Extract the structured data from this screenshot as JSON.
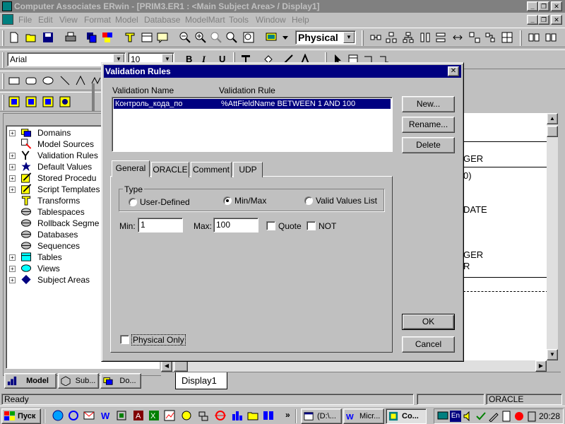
{
  "app": {
    "title": "Computer Associates ERwin - [PRIM3.ER1 : <Main Subject Area> / Display1]"
  },
  "menu": [
    "File",
    "Edit",
    "View",
    "Format",
    "Model",
    "Database",
    "ModelMart",
    "Tools",
    "Window",
    "Help"
  ],
  "toolbar": {
    "view_combo": "Physical",
    "font_combo": "Arial",
    "size_combo": "10",
    "bold": "B",
    "italic": "I",
    "underline": "U"
  },
  "tree": {
    "items": [
      {
        "label": "Domains",
        "expand": "+",
        "icon": "domain-icon"
      },
      {
        "label": "Model Sources",
        "expand": "",
        "icon": "model-source-icon"
      },
      {
        "label": "Validation Rules",
        "expand": "+",
        "icon": "validation-rule-icon"
      },
      {
        "label": "Default Values",
        "expand": "+",
        "icon": "default-value-icon"
      },
      {
        "label": "Stored Procedu",
        "expand": "+",
        "icon": "stored-procedure-icon"
      },
      {
        "label": "Script Templates",
        "expand": "+",
        "icon": "script-template-icon"
      },
      {
        "label": "Transforms",
        "expand": "",
        "icon": "transform-icon"
      },
      {
        "label": "Tablespaces",
        "expand": "",
        "icon": "tablespace-icon"
      },
      {
        "label": "Rollback Segme",
        "expand": "",
        "icon": "rollback-segment-icon"
      },
      {
        "label": "Databases",
        "expand": "",
        "icon": "database-icon"
      },
      {
        "label": "Sequences",
        "expand": "",
        "icon": "sequence-icon"
      },
      {
        "label": "Tables",
        "expand": "+",
        "icon": "table-icon"
      },
      {
        "label": "Views",
        "expand": "+",
        "icon": "view-icon"
      },
      {
        "label": "Subject Areas",
        "expand": "+",
        "icon": "subject-area-icon"
      }
    ],
    "tabs": [
      "Model",
      "Sub...",
      "Do..."
    ]
  },
  "diagram": {
    "texts": [
      "GER",
      "0)",
      "DATE",
      "GER",
      "R"
    ],
    "tab": "Display1"
  },
  "status": {
    "left": "Ready",
    "db": "ORACLE"
  },
  "taskbar": {
    "start": "Пуск",
    "buttons": [
      "(D:\\...",
      "Micr...",
      "Co..."
    ],
    "tray_lang": "En",
    "clock": "20:28"
  },
  "dialog": {
    "title": "Validation Rules",
    "col_name": "Validation Name",
    "col_rule": "Validation Rule",
    "rows": [
      {
        "name": "Контроль_кода_по",
        "rule": "%AttFieldName BETWEEN 1 AND 100"
      }
    ],
    "buttons": {
      "new": "New...",
      "rename": "Rename...",
      "delete": "Delete",
      "ok": "OK",
      "cancel": "Cancel"
    },
    "tabs": [
      "General",
      "ORACLE",
      "Comment",
      "UDP"
    ],
    "type_group": "Type",
    "radios": [
      "User-Defined",
      "Min/Max",
      "Valid Values List"
    ],
    "radio_selected": "Min/Max",
    "min_label": "Min:",
    "min_value": "1",
    "max_label": "Max:",
    "max_value": "100",
    "quote_label": "Quote",
    "not_label": "NOT",
    "physical_only": "Physical Only"
  },
  "colors": {
    "dialog_title": "#000080",
    "selection": "#000080",
    "inactive_title": "#808080",
    "face": "#c0c0c0"
  }
}
